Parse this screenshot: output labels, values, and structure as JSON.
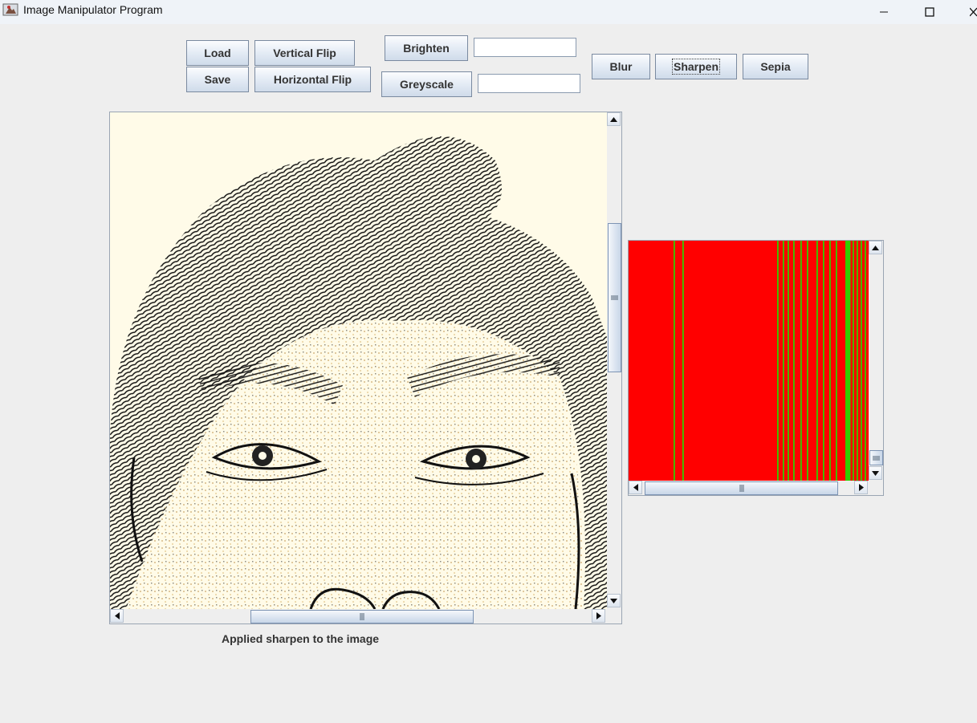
{
  "window": {
    "title": "Image Manipulator Program",
    "controls": [
      "minimize-icon",
      "maximize-icon",
      "close-icon"
    ]
  },
  "toolbar": {
    "load_label": "Load",
    "save_label": "Save",
    "vertical_flip_label": "Vertical Flip",
    "horizontal_flip_label": "Horizontal Flip",
    "brighten_label": "Brighten",
    "brighten_value": "",
    "greyscale_label": "Greyscale",
    "greyscale_value": "",
    "blur_label": "Blur",
    "sharpen_label": "Sharpen",
    "sepia_label": "Sepia"
  },
  "image_panel": {
    "content": "sharpened portrait image (face with dark hair, high-contrast edges)",
    "background_color": "#fffbe8"
  },
  "histogram_panel": {
    "background_color": "#ff0000",
    "line_color": "#33cc00"
  },
  "status": {
    "message": "Applied sharpen to the image"
  }
}
